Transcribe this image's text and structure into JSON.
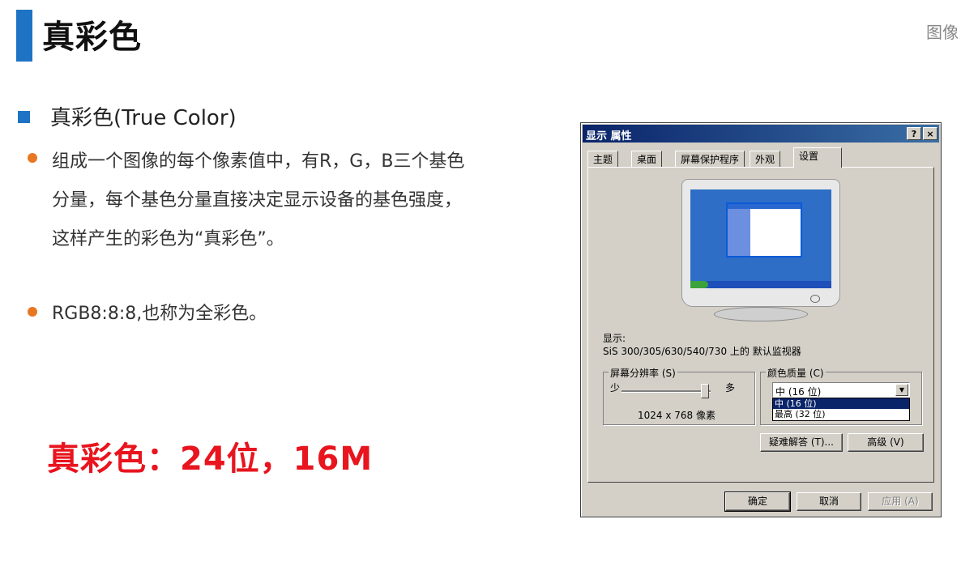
{
  "slide": {
    "title": "真彩色",
    "corner_text": "图像",
    "bullet_main": "真彩色(True Color)",
    "paragraph": "组成一个图像的每个像素值中，有R，G，B三个基色分量，每个基色分量直接决定显示设备的基色强度，这样产生的彩色为“真彩色”。",
    "bullet_2": "RGB8:8:8,也称为全彩色。",
    "highlight": "真彩色：24位，16M",
    "accent_color": "#1f73c5",
    "bullet_color": "#e87722",
    "highlight_color": "#e8141e"
  },
  "dialog": {
    "title": "显示 属性",
    "help_button": "?",
    "close_button": "×",
    "tabs": [
      {
        "label": "主题"
      },
      {
        "label": "桌面"
      },
      {
        "label": "屏幕保护程序"
      },
      {
        "label": "外观"
      },
      {
        "label": "设置"
      }
    ],
    "display_label": "显示:",
    "display_device": "SiS 300/305/630/540/730 上的 默认监视器",
    "resolution": {
      "group_title": "屏幕分辨率 (S)",
      "less": "少",
      "more": "多",
      "value": "1024 x 768 像素"
    },
    "color_quality": {
      "group_title": "颜色质量 (C)",
      "selected": "中 (16 位)",
      "options": [
        "中 (16 位)",
        "最高 (32 位)"
      ]
    },
    "troubleshoot_button": "疑难解答 (T)...",
    "advanced_button": "高级 (V)",
    "ok_button": "确定",
    "cancel_button": "取消",
    "apply_button": "应用 (A)"
  }
}
